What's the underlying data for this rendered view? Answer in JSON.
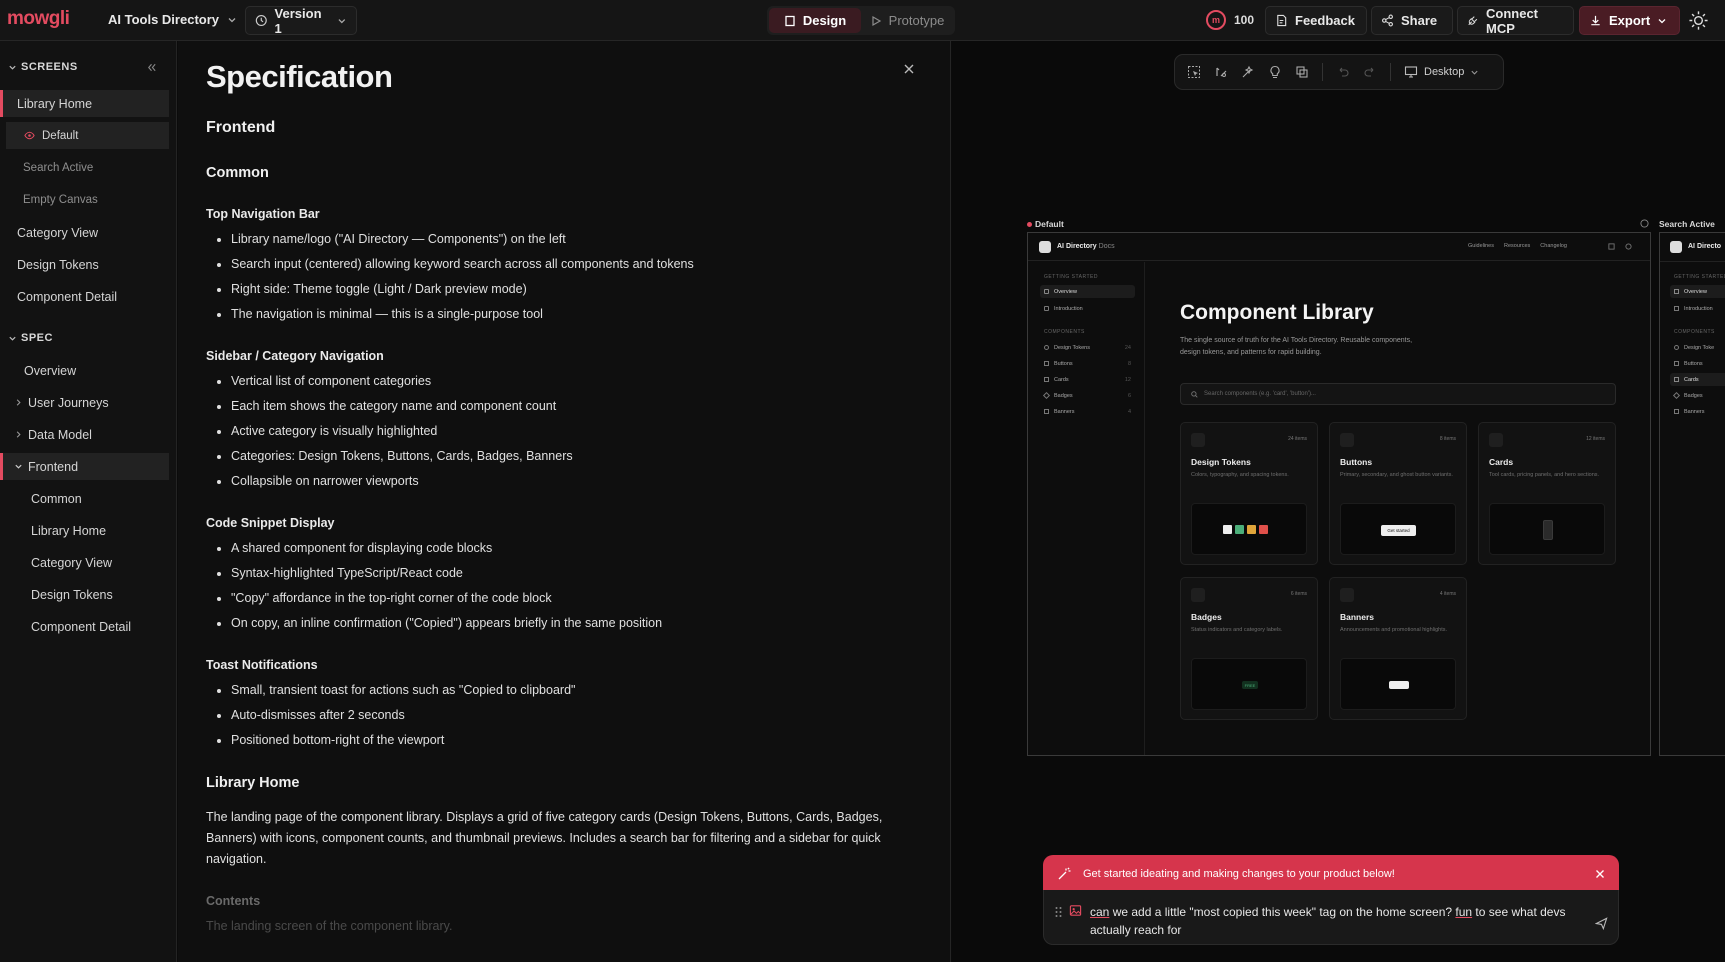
{
  "topbar": {
    "logo": "mowgli",
    "project": "AI Tools Directory",
    "version": "Version 1",
    "design_tab": "Design",
    "prototype_tab": "Prototype",
    "credits": "100",
    "feedback": "Feedback",
    "share": "Share",
    "connect": "Connect MCP",
    "export": "Export"
  },
  "sidebar": {
    "screens_label": "SCREENS",
    "screens": [
      "Library Home",
      "Default",
      "Search Active",
      "Empty Canvas",
      "Category View",
      "Design Tokens",
      "Component Detail"
    ],
    "spec_label": "SPEC",
    "spec_items": [
      "Overview",
      "User Journeys",
      "Data Model",
      "Frontend"
    ],
    "frontend_items": [
      "Common",
      "Library Home",
      "Category View",
      "Design Tokens",
      "Component Detail"
    ]
  },
  "spec": {
    "title": "Specification",
    "frontend": "Frontend",
    "common": "Common",
    "sections": [
      {
        "heading": "Top Navigation Bar",
        "items": [
          "Library name/logo (\"AI Directory — Components\") on the left",
          "Search input (centered) allowing keyword search across all components and tokens",
          "Right side: Theme toggle (Light / Dark preview mode)",
          "The navigation is minimal — this is a single-purpose tool"
        ]
      },
      {
        "heading": "Sidebar / Category Navigation",
        "items": [
          "Vertical list of component categories",
          "Each item shows the category name and component count",
          "Active category is visually highlighted",
          "Categories: Design Tokens, Buttons, Cards, Badges, Banners",
          "Collapsible on narrower viewports"
        ]
      },
      {
        "heading": "Code Snippet Display",
        "items": [
          "A shared component for displaying code blocks",
          "Syntax-highlighted TypeScript/React code",
          "\"Copy\" affordance in the top-right corner of the code block",
          "On copy, an inline confirmation (\"Copied\") appears briefly in the same position"
        ]
      },
      {
        "heading": "Toast Notifications",
        "items": [
          "Small, transient toast for actions such as \"Copied to clipboard\"",
          "Auto-dismisses after 2 seconds",
          "Positioned bottom-right of the viewport"
        ]
      }
    ],
    "library_home": "Library Home",
    "library_home_desc": "The landing page of the component library. Displays a grid of five category cards (Design Tokens, Buttons, Cards, Badges, Banners) with icons, component counts, and thumbnail previews. Includes a search bar for filtering and a sidebar for quick navigation.",
    "contents": "Contents",
    "contents_desc": "The landing screen of the component library."
  },
  "canvas": {
    "device": "Desktop",
    "frame_label": "Default",
    "frame2_label": "Search Active",
    "preview": {
      "brand": "AI Directory",
      "brand_sub": "Docs",
      "nav_links": [
        "Guidelines",
        "Resources",
        "Changelog"
      ],
      "getting_started": "GETTING STARTED",
      "gs_items": [
        "Overview",
        "Introduction"
      ],
      "components": "COMPONENTS",
      "comp_items": [
        {
          "label": "Design Tokens",
          "count": "24"
        },
        {
          "label": "Buttons",
          "count": "8"
        },
        {
          "label": "Cards",
          "count": "12"
        },
        {
          "label": "Badges",
          "count": "6"
        },
        {
          "label": "Banners",
          "count": "4"
        }
      ],
      "title": "Component Library",
      "desc": "The single source of truth for the AI Tools Directory. Reusable components, design tokens, and patterns for rapid building.",
      "search_placeholder": "Search components (e.g. 'card', 'button')...",
      "cards": [
        {
          "title": "Design Tokens",
          "count": "24 items",
          "desc": "Colors, typography, and spacing tokens."
        },
        {
          "title": "Buttons",
          "count": "8 items",
          "desc": "Primary, secondary, and ghost button variants."
        },
        {
          "title": "Cards",
          "count": "12 items",
          "desc": "Tool cards, pricing panels, and hero sections."
        },
        {
          "title": "Badges",
          "count": "6 items",
          "desc": "Status indicators and category labels."
        },
        {
          "title": "Banners",
          "count": "4 items",
          "desc": "Announcements and promotional highlights."
        }
      ],
      "btn_preview": "Get started",
      "badge_preview": "FREE",
      "frame2_brand": "AI Directo",
      "frame2_items": [
        "Overview",
        "Introduction",
        "Design Toke",
        "Buttons",
        "Cards",
        "Badges",
        "Banners"
      ]
    }
  },
  "assistant": {
    "banner": "Get started ideating and making changes to your product below!",
    "message_parts": [
      "can",
      " we add a little \"most copied this week\" tag on the home screen? ",
      "fun",
      " to see what devs actually reach for"
    ]
  },
  "colors": {
    "accent": "#e34b60",
    "banner": "#d6354c"
  }
}
